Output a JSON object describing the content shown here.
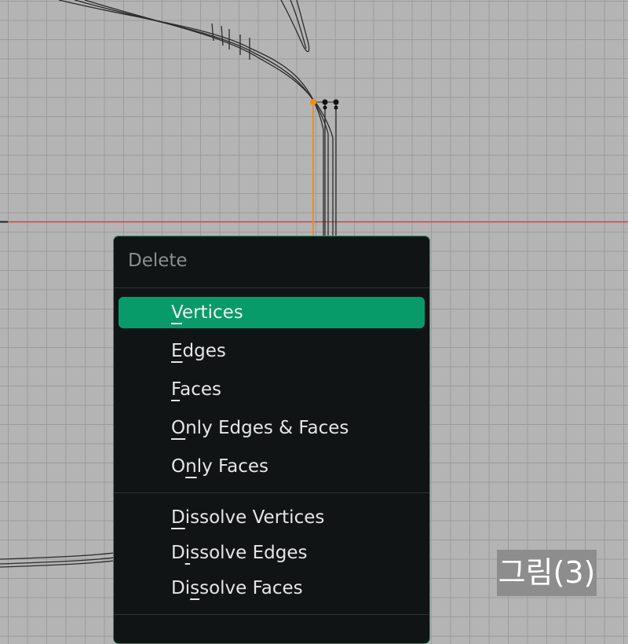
{
  "menu": {
    "title": "Delete",
    "groups": [
      [
        {
          "name": "menu-item-vertices",
          "ul": "V",
          "rest": "ertices",
          "active": true
        },
        {
          "name": "menu-item-edges",
          "ul": "E",
          "rest": "dges"
        },
        {
          "name": "menu-item-faces",
          "ul": "F",
          "rest": "aces"
        },
        {
          "name": "menu-item-only-edges-faces",
          "ul": "O",
          "rest": "nly Edges & Faces"
        },
        {
          "name": "menu-item-only-faces",
          "pre": "O",
          "ul": "n",
          "rest": "ly Faces"
        }
      ],
      [
        {
          "name": "menu-item-dissolve-vertices",
          "ul": "D",
          "rest": "issolve Vertices"
        },
        {
          "name": "menu-item-dissolve-edges",
          "pre": "D",
          "ul": "i",
          "rest": "ssolve Edges"
        },
        {
          "name": "menu-item-dissolve-faces",
          "pre": "Di",
          "ul": "s",
          "rest": "solve Faces"
        }
      ]
    ]
  },
  "caption": "그림(3)",
  "colors": {
    "accent": "#079b6a",
    "menu_border": "#1f9a6c",
    "selected_edge": "#f0900a",
    "x_axis": "#c9444a"
  }
}
